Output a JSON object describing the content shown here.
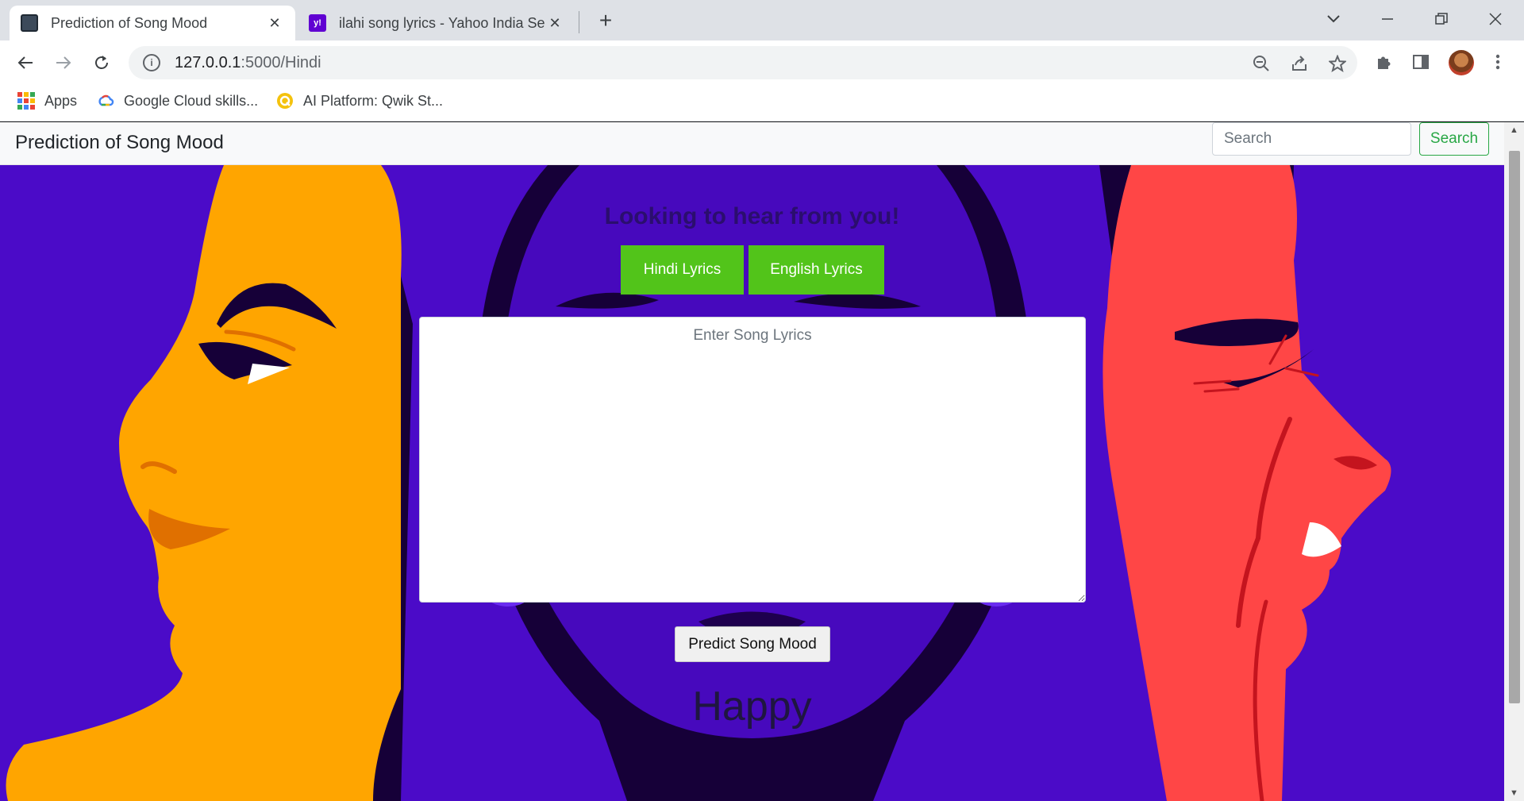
{
  "browser": {
    "tabs": [
      {
        "title": "Prediction of Song Mood",
        "icon": "terminal-icon"
      },
      {
        "title": "ilahi song lyrics - Yahoo India Sea",
        "icon": "yahoo-icon"
      }
    ],
    "url_host": "127.0.0.1",
    "url_rest": ":5000/Hindi",
    "bookmarks": [
      {
        "label": "Apps",
        "icon": "apps-grid-icon"
      },
      {
        "label": "Google Cloud skills...",
        "icon": "google-cloud-icon"
      },
      {
        "label": "AI Platform: Qwik St...",
        "icon": "qwiklabs-icon"
      }
    ]
  },
  "site": {
    "brand": "Prediction of Song Mood",
    "search_placeholder": "Search",
    "search_button": "Search"
  },
  "main": {
    "heading": "Looking to hear from you!",
    "hindi_button": "Hindi Lyrics",
    "english_button": "English Lyrics",
    "lyrics_placeholder": "Enter Song Lyrics",
    "predict_button": "Predict Song Mood",
    "result": "Happy"
  },
  "colors": {
    "hero_background": "#4b0bc8",
    "accent_green": "#52c41a",
    "search_green": "#28a745",
    "face_orange": "#ffa500",
    "face_red": "#ff4646"
  }
}
